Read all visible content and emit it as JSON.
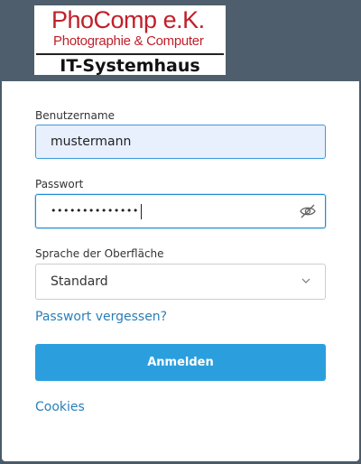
{
  "logo": {
    "line1": "PhoComp e.K.",
    "line2": "Photographie & Computer",
    "line3": "IT-Systemhaus"
  },
  "form": {
    "username_label": "Benutzername",
    "username_value": "mustermann",
    "password_label": "Passwort",
    "password_masked": "••••••••••••••",
    "language_label": "Sprache der Oberfläche",
    "language_value": "Standard",
    "forgot_link": "Passwort vergessen?",
    "submit_label": "Anmelden",
    "cookies_link": "Cookies"
  },
  "colors": {
    "header": "#4e5e6d",
    "accent": "#2b9fde",
    "link": "#2a7fb8",
    "logo_red": "#c0202a"
  },
  "icons": {
    "password_toggle": "eye-slash-icon",
    "select_toggle": "chevron-down-icon"
  }
}
